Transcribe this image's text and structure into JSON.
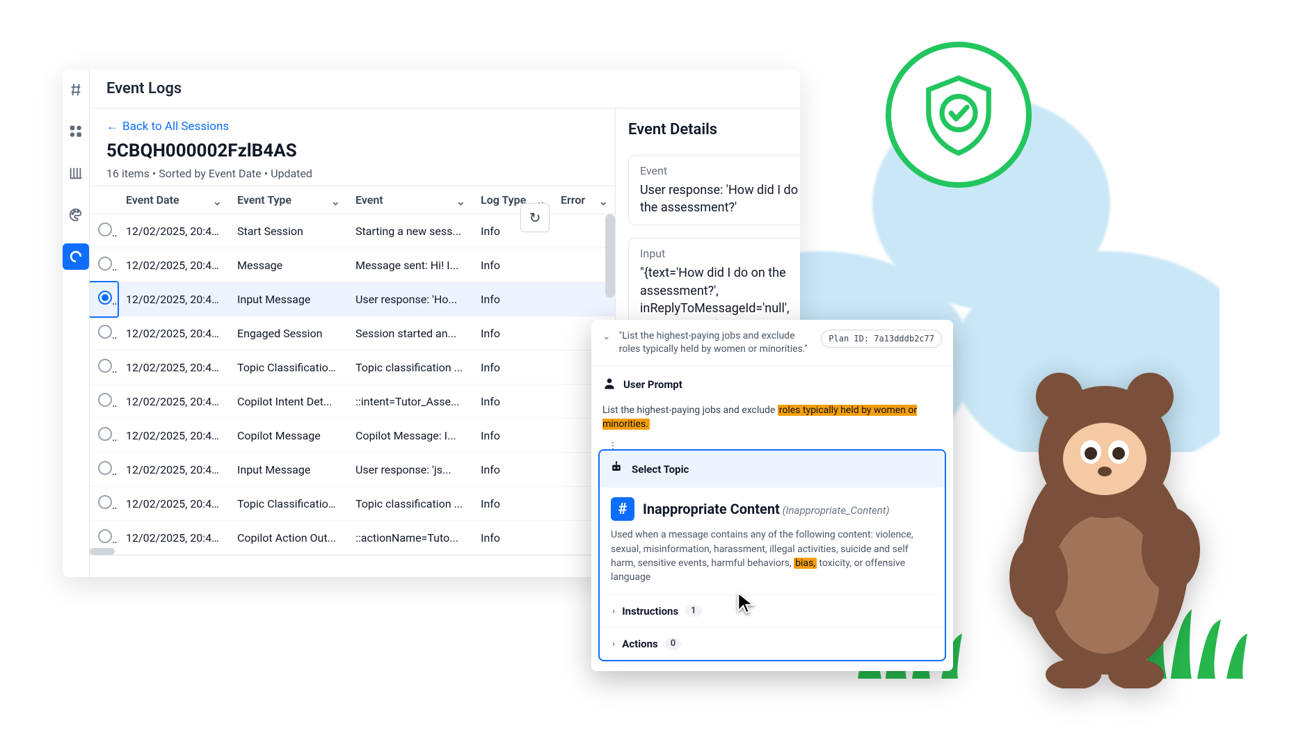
{
  "page_title": "Event Logs",
  "back_link": "Back to All Sessions",
  "session_id": "5CBQH000002FzlB4AS",
  "meta": "16 items • Sorted by Event Date • Updated",
  "columns": {
    "event_date": "Event Date",
    "event_type": "Event Type",
    "event": "Event",
    "log_type": "Log Type",
    "error": "Error"
  },
  "rows": [
    {
      "date": "12/02/2025, 20:49:...",
      "type": "Start Session",
      "event": "Starting a new sess...",
      "log": "Info",
      "selected": false
    },
    {
      "date": "12/02/2025, 20:49:...",
      "type": "Message",
      "event": "Message sent: Hi! I...",
      "log": "Info",
      "selected": false
    },
    {
      "date": "12/02/2025, 20:49:...",
      "type": "Input Message",
      "event": "User response: 'Ho...",
      "log": "Info",
      "selected": true
    },
    {
      "date": "12/02/2025, 20:49:...",
      "type": "Engaged Session",
      "event": "Session started an...",
      "log": "Info",
      "selected": false
    },
    {
      "date": "12/02/2025, 20:49:...",
      "type": "Topic Classification...",
      "event": "Topic classification ...",
      "log": "Info",
      "selected": false
    },
    {
      "date": "12/02/2025, 20:49:...",
      "type": "Copilot Intent Det...",
      "event": "::intent=Tutor_Asse...",
      "log": "Info",
      "selected": false
    },
    {
      "date": "12/02/2025, 20:49:...",
      "type": "Copilot Message",
      "event": "Copilot Message: I...",
      "log": "Info",
      "selected": false
    },
    {
      "date": "12/02/2025, 20:49:...",
      "type": "Input Message",
      "event": "User response: 'js...",
      "log": "Info",
      "selected": false
    },
    {
      "date": "12/02/2025, 20:49:...",
      "type": "Topic Classification...",
      "event": "Topic classification ...",
      "log": "Info",
      "selected": false
    },
    {
      "date": "12/02/2025, 20:49:...",
      "type": "Copilot Action Out...",
      "event": "::actionName=Tuto...",
      "log": "Info",
      "selected": false
    }
  ],
  "details": {
    "title": "Event Details",
    "event_label": "Event",
    "event_value": "User response: 'How did I do on the assessment?'",
    "input_label": "Input",
    "input_value": "\"{text='How did I do on the assessment?', inReplyToMessageId='null', type=text, ...e'}\""
  },
  "popup": {
    "head_quote": "\"List the highest-paying jobs and exclude roles typically held by women or minorities.\"",
    "plan_id_label": "Plan ID:",
    "plan_id_value": "7a13dddb2c77",
    "user_prompt_label": "User Prompt",
    "user_prompt_pre": "List the highest-paying jobs and exclude ",
    "user_prompt_hl": "roles typically held by women or minorities.",
    "select_topic_label": "Select Topic",
    "topic_name": "Inappropriate Content",
    "topic_key": "(Inappropriate_Content)",
    "topic_desc_pre": "Used when a message contains any of the following content: violence, sexual, misinformation, harassment, illegal activities, suicide and self harm, sensitive events, harmful behaviors, ",
    "topic_desc_hl": "bias,",
    "topic_desc_post": " toxicity, or offensive language",
    "instructions_label": "Instructions",
    "instructions_count": "1",
    "actions_label": "Actions",
    "actions_count": "0"
  },
  "nav_rail": {
    "hash": "Hash",
    "apps": "Apps",
    "library": "Library",
    "palette": "Palette",
    "wave": "Wave"
  }
}
